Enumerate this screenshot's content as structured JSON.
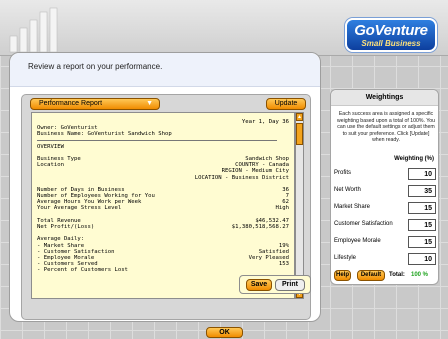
{
  "header": {
    "logo_main": "GoVenture",
    "logo_sub": "Small Business",
    "instruction": "Review a report on your performance."
  },
  "report": {
    "selector_label": "Performance Report",
    "update_label": "Update",
    "save_label": "Save",
    "print_label": "Print",
    "header_right": "Year 1, Day 36",
    "owner_line": "Owner: GoVenturist",
    "business_name_line": "Business Name: GoVenturist Sandwich Shop",
    "overview_title": "OVERVIEW",
    "rows_a": [
      {
        "label": "Business Type",
        "value": "Sandwich Shop"
      },
      {
        "label": "Location",
        "value": "COUNTRY - Canada"
      },
      {
        "label": "",
        "value": "REGION - Medium City"
      },
      {
        "label": "",
        "value": "LOCATION - Business District"
      }
    ],
    "rows_b": [
      {
        "label": "Number of Days in Business",
        "value": "36"
      },
      {
        "label": "Number of Employees Working for You",
        "value": "7"
      },
      {
        "label": "Average Hours You Work per Week",
        "value": "62"
      },
      {
        "label": "Your Average Stress Level",
        "value": "High"
      }
    ],
    "rows_c": [
      {
        "label": "Total Revenue",
        "value": "$46,532.47"
      },
      {
        "label": "Net Profit/(Loss)",
        "value": "$1,380,518,568.27"
      }
    ],
    "daily_title": "Average Daily:",
    "rows_d": [
      {
        "label": "- Market Share",
        "value": "19%"
      },
      {
        "label": "- Customer Satisfaction",
        "value": "Satisfied"
      },
      {
        "label": "- Employee Morale",
        "value": "Very Pleased"
      },
      {
        "label": "- Customers Served",
        "value": "153"
      },
      {
        "label": "- Percent of Customers Lost",
        "value": ""
      }
    ]
  },
  "weights": {
    "title": "Weightings",
    "description": "Each success area is assigned a specific weighting based upon a total of 100%. You can use the default settings or adjust them to suit your preference. Click [Update] when ready.",
    "heading": "Weighting (%)",
    "rows": [
      {
        "label": "Profits",
        "value": "10"
      },
      {
        "label": "Net Worth",
        "value": "35"
      },
      {
        "label": "Market Share",
        "value": "15"
      },
      {
        "label": "Customer Satisfaction",
        "value": "15"
      },
      {
        "label": "Employee Morale",
        "value": "15"
      },
      {
        "label": "Lifestyle",
        "value": "10"
      }
    ],
    "help_label": "Help",
    "default_label": "Default",
    "total_label": "Total:",
    "total_value": "100 %"
  },
  "footer": {
    "ok_label": "OK"
  },
  "colors": {
    "button_orange": "#f3a41e",
    "report_paper": "#fffcd2",
    "total_green": "#1ea31e",
    "logo_blue": "#1f5fc8"
  }
}
